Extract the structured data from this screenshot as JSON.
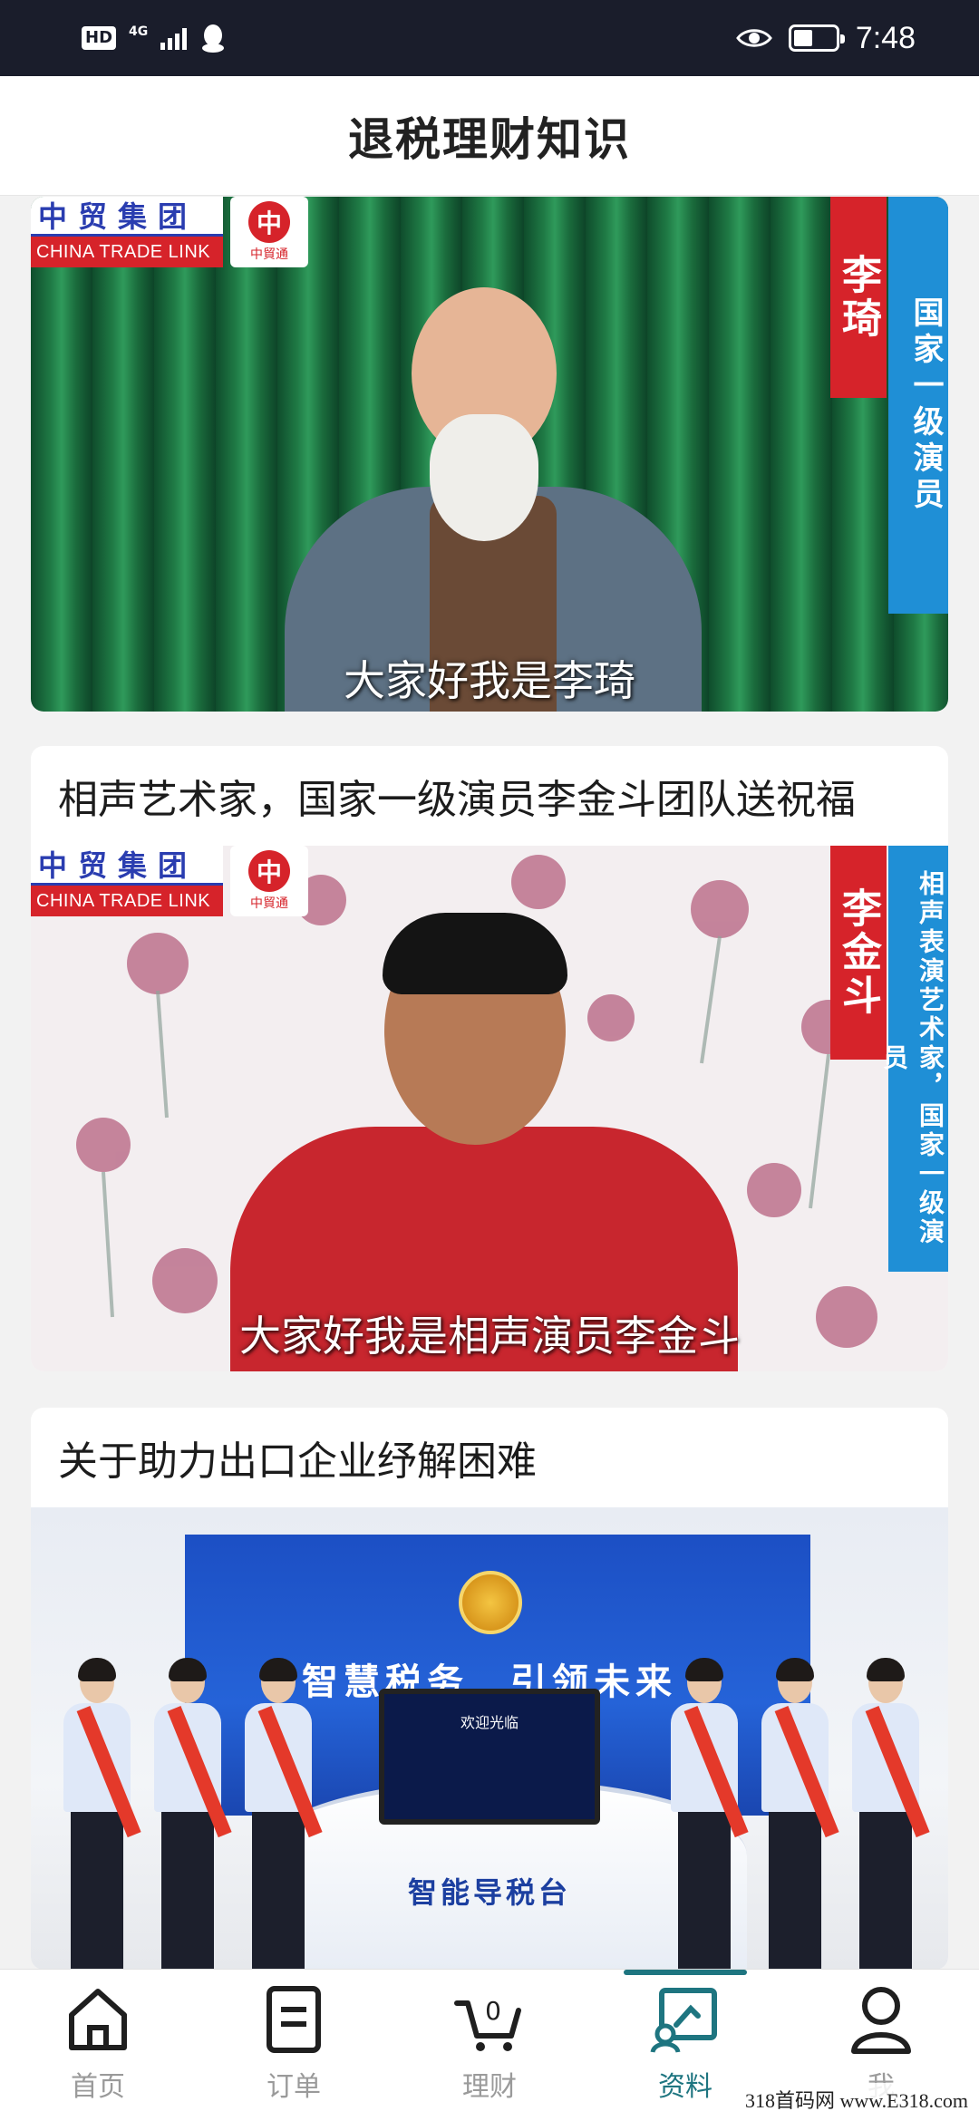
{
  "status_bar": {
    "hd_label": "HD",
    "network_label": "4G",
    "time": "7:48"
  },
  "header": {
    "title": "退税理财知识"
  },
  "feed": {
    "cards": [
      {
        "title": "",
        "brand_zh": "中贸集团",
        "brand_en": "CHINA TRADE LINK",
        "logo_text": "中貿通",
        "logo_mark": "中",
        "name_tag": "李琦",
        "title_tag": "国家一级演员",
        "subtitle": "大家好我是李琦"
      },
      {
        "title": "相声艺术家，国家一级演员李金斗团队送祝福",
        "brand_zh": "中贸集团",
        "brand_en": "CHINA TRADE LINK",
        "logo_text": "中貿通",
        "logo_mark": "中",
        "name_tag": "李金斗",
        "title_tag": "相声表演艺术家，国家一级演员",
        "subtitle": "大家好我是相声演员李金斗"
      },
      {
        "title": "关于助力出口企业纾解困难",
        "slogan": "智慧税务　引领未来",
        "screen_title": "欢迎光临",
        "desk_text": "智能导税台"
      }
    ]
  },
  "bottom_nav": {
    "items": [
      {
        "label": "首页",
        "icon": "home-icon"
      },
      {
        "label": "订单",
        "icon": "order-icon"
      },
      {
        "label": "理财",
        "icon": "cart-icon",
        "badge": "0"
      },
      {
        "label": "资料",
        "icon": "data-icon",
        "active": true
      },
      {
        "label": "我",
        "icon": "user-icon"
      }
    ],
    "active_color": "#1e7580",
    "inactive_color": "#9a9a9a"
  },
  "watermark": "318首码网 www.E318.com"
}
